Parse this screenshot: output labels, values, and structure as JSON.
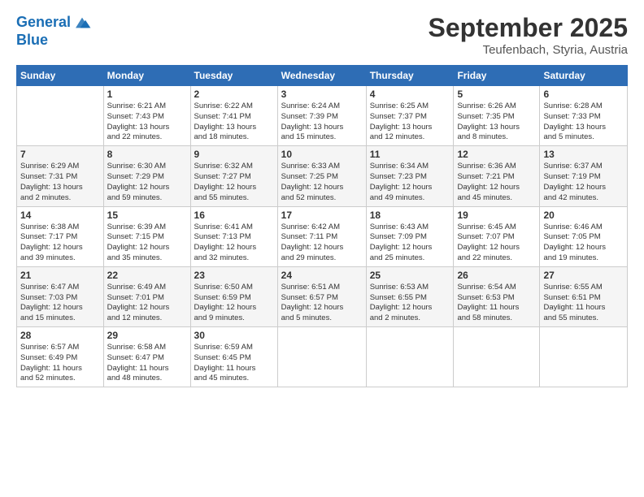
{
  "logo": {
    "line1": "General",
    "line2": "Blue"
  },
  "title": "September 2025",
  "subtitle": "Teufenbach, Styria, Austria",
  "days_header": [
    "Sunday",
    "Monday",
    "Tuesday",
    "Wednesday",
    "Thursday",
    "Friday",
    "Saturday"
  ],
  "weeks": [
    [
      {
        "num": "",
        "info": ""
      },
      {
        "num": "1",
        "info": "Sunrise: 6:21 AM\nSunset: 7:43 PM\nDaylight: 13 hours\nand 22 minutes."
      },
      {
        "num": "2",
        "info": "Sunrise: 6:22 AM\nSunset: 7:41 PM\nDaylight: 13 hours\nand 18 minutes."
      },
      {
        "num": "3",
        "info": "Sunrise: 6:24 AM\nSunset: 7:39 PM\nDaylight: 13 hours\nand 15 minutes."
      },
      {
        "num": "4",
        "info": "Sunrise: 6:25 AM\nSunset: 7:37 PM\nDaylight: 13 hours\nand 12 minutes."
      },
      {
        "num": "5",
        "info": "Sunrise: 6:26 AM\nSunset: 7:35 PM\nDaylight: 13 hours\nand 8 minutes."
      },
      {
        "num": "6",
        "info": "Sunrise: 6:28 AM\nSunset: 7:33 PM\nDaylight: 13 hours\nand 5 minutes."
      }
    ],
    [
      {
        "num": "7",
        "info": "Sunrise: 6:29 AM\nSunset: 7:31 PM\nDaylight: 13 hours\nand 2 minutes."
      },
      {
        "num": "8",
        "info": "Sunrise: 6:30 AM\nSunset: 7:29 PM\nDaylight: 12 hours\nand 59 minutes."
      },
      {
        "num": "9",
        "info": "Sunrise: 6:32 AM\nSunset: 7:27 PM\nDaylight: 12 hours\nand 55 minutes."
      },
      {
        "num": "10",
        "info": "Sunrise: 6:33 AM\nSunset: 7:25 PM\nDaylight: 12 hours\nand 52 minutes."
      },
      {
        "num": "11",
        "info": "Sunrise: 6:34 AM\nSunset: 7:23 PM\nDaylight: 12 hours\nand 49 minutes."
      },
      {
        "num": "12",
        "info": "Sunrise: 6:36 AM\nSunset: 7:21 PM\nDaylight: 12 hours\nand 45 minutes."
      },
      {
        "num": "13",
        "info": "Sunrise: 6:37 AM\nSunset: 7:19 PM\nDaylight: 12 hours\nand 42 minutes."
      }
    ],
    [
      {
        "num": "14",
        "info": "Sunrise: 6:38 AM\nSunset: 7:17 PM\nDaylight: 12 hours\nand 39 minutes."
      },
      {
        "num": "15",
        "info": "Sunrise: 6:39 AM\nSunset: 7:15 PM\nDaylight: 12 hours\nand 35 minutes."
      },
      {
        "num": "16",
        "info": "Sunrise: 6:41 AM\nSunset: 7:13 PM\nDaylight: 12 hours\nand 32 minutes."
      },
      {
        "num": "17",
        "info": "Sunrise: 6:42 AM\nSunset: 7:11 PM\nDaylight: 12 hours\nand 29 minutes."
      },
      {
        "num": "18",
        "info": "Sunrise: 6:43 AM\nSunset: 7:09 PM\nDaylight: 12 hours\nand 25 minutes."
      },
      {
        "num": "19",
        "info": "Sunrise: 6:45 AM\nSunset: 7:07 PM\nDaylight: 12 hours\nand 22 minutes."
      },
      {
        "num": "20",
        "info": "Sunrise: 6:46 AM\nSunset: 7:05 PM\nDaylight: 12 hours\nand 19 minutes."
      }
    ],
    [
      {
        "num": "21",
        "info": "Sunrise: 6:47 AM\nSunset: 7:03 PM\nDaylight: 12 hours\nand 15 minutes."
      },
      {
        "num": "22",
        "info": "Sunrise: 6:49 AM\nSunset: 7:01 PM\nDaylight: 12 hours\nand 12 minutes."
      },
      {
        "num": "23",
        "info": "Sunrise: 6:50 AM\nSunset: 6:59 PM\nDaylight: 12 hours\nand 9 minutes."
      },
      {
        "num": "24",
        "info": "Sunrise: 6:51 AM\nSunset: 6:57 PM\nDaylight: 12 hours\nand 5 minutes."
      },
      {
        "num": "25",
        "info": "Sunrise: 6:53 AM\nSunset: 6:55 PM\nDaylight: 12 hours\nand 2 minutes."
      },
      {
        "num": "26",
        "info": "Sunrise: 6:54 AM\nSunset: 6:53 PM\nDaylight: 11 hours\nand 58 minutes."
      },
      {
        "num": "27",
        "info": "Sunrise: 6:55 AM\nSunset: 6:51 PM\nDaylight: 11 hours\nand 55 minutes."
      }
    ],
    [
      {
        "num": "28",
        "info": "Sunrise: 6:57 AM\nSunset: 6:49 PM\nDaylight: 11 hours\nand 52 minutes."
      },
      {
        "num": "29",
        "info": "Sunrise: 6:58 AM\nSunset: 6:47 PM\nDaylight: 11 hours\nand 48 minutes."
      },
      {
        "num": "30",
        "info": "Sunrise: 6:59 AM\nSunset: 6:45 PM\nDaylight: 11 hours\nand 45 minutes."
      },
      {
        "num": "",
        "info": ""
      },
      {
        "num": "",
        "info": ""
      },
      {
        "num": "",
        "info": ""
      },
      {
        "num": "",
        "info": ""
      }
    ]
  ]
}
